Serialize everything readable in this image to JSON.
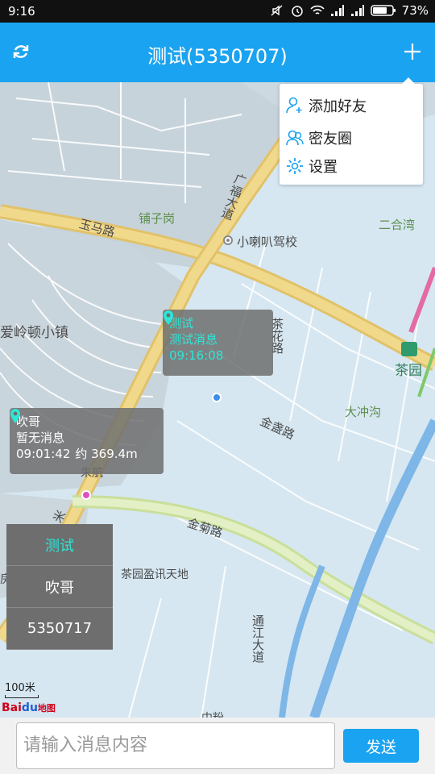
{
  "status_bar": {
    "time": "9:16",
    "battery": "73%"
  },
  "header": {
    "title": "测试(5350707)",
    "accent": "#1aa3f0"
  },
  "menu": {
    "items": [
      {
        "label": "添加好友",
        "icon": "add-user-icon"
      },
      {
        "label": "密友圈",
        "icon": "friends-icon"
      },
      {
        "label": "设置",
        "icon": "gear-icon"
      }
    ]
  },
  "map": {
    "labels": {
      "puzi_gang": "铺子岗",
      "guangfu_dadao": "广福大道",
      "yuma_lu": "玉马路",
      "xiaolaba": "小喇叭驾校",
      "erhewan": "二合湾",
      "aling_dun": "爱岭顿小镇",
      "chahua_lu": "茶花路",
      "chayuan": "茶园",
      "dachonggou": "大冲沟",
      "jinzhan_lu": "金盏路",
      "zhuhang": "朱航",
      "jinju_lu": "金菊路",
      "chayuan_yingxun": "茶园盈讯天地",
      "tongjiang_dadao": "通江大道",
      "mi": "米",
      "fang": "房",
      "zhong": "中粉"
    },
    "marker_test": {
      "name": "测试",
      "message": "测试消息",
      "time": "09:16:08"
    },
    "marker_chuige": {
      "name": "吹哥",
      "message": "暂无消息",
      "time": "09:01:42",
      "distance": "约 369.4m"
    },
    "scale": "100米",
    "logo": {
      "bai": "Bai",
      "du": "du",
      "ditu": "地图"
    }
  },
  "side_list": {
    "items": [
      "测试",
      "吹哥",
      "5350717"
    ],
    "active_index": 0
  },
  "composer": {
    "placeholder": "请输入消息内容",
    "send_label": "发送"
  }
}
